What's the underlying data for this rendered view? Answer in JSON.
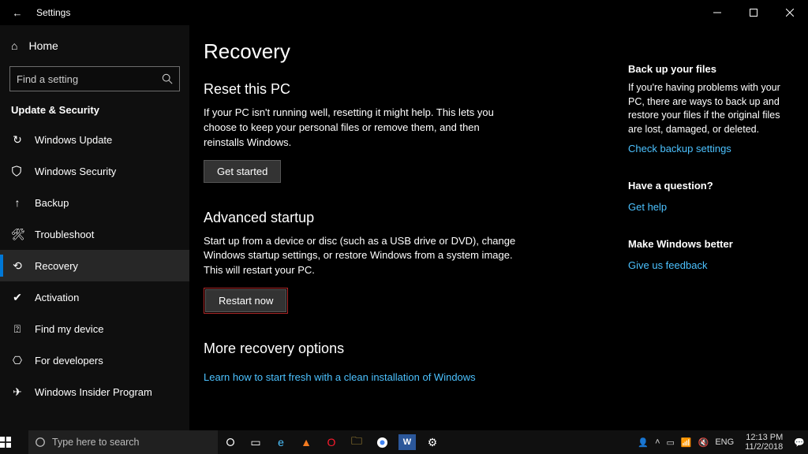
{
  "titlebar": {
    "title": "Settings"
  },
  "sidebar": {
    "home": "Home",
    "search_placeholder": "Find a setting",
    "category": "Update & Security",
    "items": [
      {
        "label": "Windows Update"
      },
      {
        "label": "Windows Security"
      },
      {
        "label": "Backup"
      },
      {
        "label": "Troubleshoot"
      },
      {
        "label": "Recovery"
      },
      {
        "label": "Activation"
      },
      {
        "label": "Find my device"
      },
      {
        "label": "For developers"
      },
      {
        "label": "Windows Insider Program"
      }
    ]
  },
  "page": {
    "heading": "Recovery",
    "reset": {
      "title": "Reset this PC",
      "desc": "If your PC isn't running well, resetting it might help. This lets you choose to keep your personal files or remove them, and then reinstalls Windows.",
      "button": "Get started"
    },
    "advanced": {
      "title": "Advanced startup",
      "desc": "Start up from a device or disc (such as a USB drive or DVD), change Windows startup settings, or restore Windows from a system image. This will restart your PC.",
      "button": "Restart now"
    },
    "more": {
      "title": "More recovery options",
      "link": "Learn how to start fresh with a clean installation of Windows"
    }
  },
  "right": {
    "backup": {
      "title": "Back up your files",
      "desc": "If you're having problems with your PC, there are ways to back up and restore your files if the original files are lost, damaged, or deleted.",
      "link": "Check backup settings"
    },
    "question": {
      "title": "Have a question?",
      "link": "Get help"
    },
    "feedback": {
      "title": "Make Windows better",
      "link": "Give us feedback"
    }
  },
  "taskbar": {
    "search_placeholder": "Type here to search",
    "lang": "ENG",
    "time": "12:13 PM",
    "date": "11/2/2018"
  }
}
